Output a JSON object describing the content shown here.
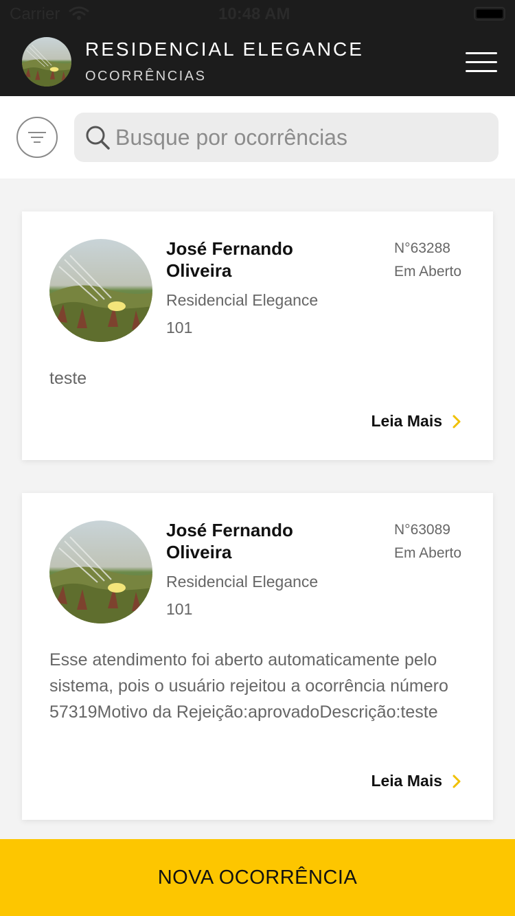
{
  "status_bar": {
    "carrier": "Carrier",
    "time": "10:48 AM"
  },
  "header": {
    "title": "RESIDENCIAL ELEGANCE",
    "subtitle": "OCORRÊNCIAS"
  },
  "search": {
    "placeholder": "Busque por ocorrências",
    "value": ""
  },
  "occurrences": [
    {
      "name": "José Fernando Oliveira",
      "condo": "Residencial Elegance",
      "unit": "101",
      "number": "N°63288",
      "status": "Em Aberto",
      "description": "teste",
      "read_more": "Leia Mais"
    },
    {
      "name": "José Fernando Oliveira",
      "condo": "Residencial Elegance",
      "unit": "101",
      "number": "N°63089",
      "status": "Em Aberto",
      "description": "Esse atendimento foi aberto automaticamente pelo sistema, pois o usuário rejeitou a ocorrência número 57319Motivo da Rejeição:aprovadoDescrição:teste",
      "read_more": "Leia Mais"
    }
  ],
  "cta": {
    "label": "NOVA OCORRÊNCIA"
  },
  "colors": {
    "header_bg": "#1c1c1c",
    "accent": "#fdc600",
    "chevron": "#f0c000"
  },
  "icons": [
    "wifi-icon",
    "battery-icon",
    "menu-icon",
    "filter-icon",
    "search-icon",
    "chevron-right-icon"
  ]
}
